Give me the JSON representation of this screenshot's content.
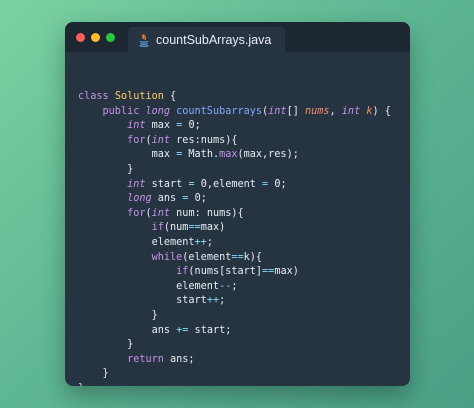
{
  "editor": {
    "tab_title": "countSubArrays.java",
    "tab_icon": "java-icon",
    "window_controls": [
      "close",
      "minimize",
      "maximize"
    ]
  },
  "code_lines": [
    [
      {
        "t": "class ",
        "c": "keyword"
      },
      {
        "t": "Solution",
        "c": "classname"
      },
      {
        "t": " {",
        "c": "plain"
      }
    ],
    [
      {
        "t": "    public ",
        "c": "keyword"
      },
      {
        "t": "long ",
        "c": "type"
      },
      {
        "t": "countSubarrays",
        "c": "fn"
      },
      {
        "t": "(",
        "c": "plain"
      },
      {
        "t": "int",
        "c": "type"
      },
      {
        "t": "[] ",
        "c": "plain"
      },
      {
        "t": "nums",
        "c": "param"
      },
      {
        "t": ", ",
        "c": "plain"
      },
      {
        "t": "int ",
        "c": "type"
      },
      {
        "t": "k",
        "c": "param"
      },
      {
        "t": ") {",
        "c": "plain"
      }
    ],
    [
      {
        "t": "        ",
        "c": "plain"
      },
      {
        "t": "int ",
        "c": "type"
      },
      {
        "t": "max ",
        "c": "plain"
      },
      {
        "t": "=",
        "c": "op"
      },
      {
        "t": " 0;",
        "c": "plain"
      }
    ],
    [
      {
        "t": "        ",
        "c": "plain"
      },
      {
        "t": "for",
        "c": "keyword"
      },
      {
        "t": "(",
        "c": "plain"
      },
      {
        "t": "int ",
        "c": "type"
      },
      {
        "t": "res:nums){",
        "c": "plain"
      }
    ],
    [
      {
        "t": "            max ",
        "c": "plain"
      },
      {
        "t": "=",
        "c": "op"
      },
      {
        "t": " Math.",
        "c": "plain"
      },
      {
        "t": "max",
        "c": "method"
      },
      {
        "t": "(max,res);",
        "c": "plain"
      }
    ],
    [
      {
        "t": "        }",
        "c": "plain"
      }
    ],
    [
      {
        "t": "        ",
        "c": "plain"
      },
      {
        "t": "int ",
        "c": "type"
      },
      {
        "t": "start ",
        "c": "plain"
      },
      {
        "t": "=",
        "c": "op"
      },
      {
        "t": " 0,element ",
        "c": "plain"
      },
      {
        "t": "=",
        "c": "op"
      },
      {
        "t": " 0;",
        "c": "plain"
      }
    ],
    [
      {
        "t": "        ",
        "c": "plain"
      },
      {
        "t": "long ",
        "c": "type"
      },
      {
        "t": "ans ",
        "c": "plain"
      },
      {
        "t": "=",
        "c": "op"
      },
      {
        "t": " 0;",
        "c": "plain"
      }
    ],
    [
      {
        "t": "        ",
        "c": "plain"
      },
      {
        "t": "for",
        "c": "keyword"
      },
      {
        "t": "(",
        "c": "plain"
      },
      {
        "t": "int ",
        "c": "type"
      },
      {
        "t": "num: nums){",
        "c": "plain"
      }
    ],
    [
      {
        "t": "            ",
        "c": "plain"
      },
      {
        "t": "if",
        "c": "keyword"
      },
      {
        "t": "(num",
        "c": "plain"
      },
      {
        "t": "==",
        "c": "op"
      },
      {
        "t": "max)",
        "c": "plain"
      }
    ],
    [
      {
        "t": "            element",
        "c": "plain"
      },
      {
        "t": "++",
        "c": "op"
      },
      {
        "t": ";",
        "c": "plain"
      }
    ],
    [
      {
        "t": "            ",
        "c": "plain"
      },
      {
        "t": "while",
        "c": "keyword"
      },
      {
        "t": "(element",
        "c": "plain"
      },
      {
        "t": "==",
        "c": "op"
      },
      {
        "t": "k){",
        "c": "plain"
      }
    ],
    [
      {
        "t": "                ",
        "c": "plain"
      },
      {
        "t": "if",
        "c": "keyword"
      },
      {
        "t": "(nums[start]",
        "c": "plain"
      },
      {
        "t": "==",
        "c": "op"
      },
      {
        "t": "max)",
        "c": "plain"
      }
    ],
    [
      {
        "t": "                element",
        "c": "plain"
      },
      {
        "t": "--",
        "c": "op"
      },
      {
        "t": ";",
        "c": "plain"
      }
    ],
    [
      {
        "t": "                start",
        "c": "plain"
      },
      {
        "t": "++",
        "c": "op"
      },
      {
        "t": ";",
        "c": "plain"
      }
    ],
    [
      {
        "t": "            }",
        "c": "plain"
      }
    ],
    [
      {
        "t": "            ans ",
        "c": "plain"
      },
      {
        "t": "+=",
        "c": "op"
      },
      {
        "t": " start;",
        "c": "plain"
      }
    ],
    [
      {
        "t": "        }",
        "c": "plain"
      }
    ],
    [
      {
        "t": "        ",
        "c": "plain"
      },
      {
        "t": "return ",
        "c": "keyword"
      },
      {
        "t": "ans;",
        "c": "plain"
      }
    ],
    [
      {
        "t": "    }",
        "c": "plain"
      }
    ],
    [
      {
        "t": "}",
        "c": "plain"
      }
    ]
  ]
}
